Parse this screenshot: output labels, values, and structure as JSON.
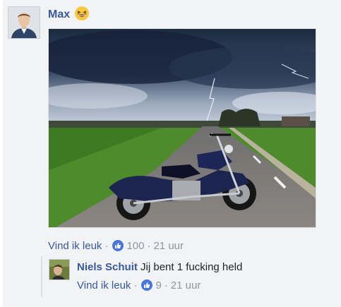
{
  "post": {
    "author": "Max",
    "emoji": "grinning-squinting-face-icon",
    "actions": {
      "like_label": "Vind ik leuk",
      "separator": "·",
      "reaction_icon": "thumbs-up-icon",
      "reaction_count": "100",
      "time_sep": "·",
      "time": "21 uur"
    }
  },
  "reply": {
    "author": "Niels Schuit",
    "text": "Jij bent 1 fucking held",
    "actions": {
      "like_label": "Vind ik leuk",
      "separator": "·",
      "reaction_icon": "thumbs-up-icon",
      "reaction_count": "9",
      "time_sep": "·",
      "time": "21 uur"
    }
  },
  "colors": {
    "link": "#385898",
    "muted": "#90949c",
    "background": "#f2f3f5",
    "like_blue": "#4a76d8"
  }
}
